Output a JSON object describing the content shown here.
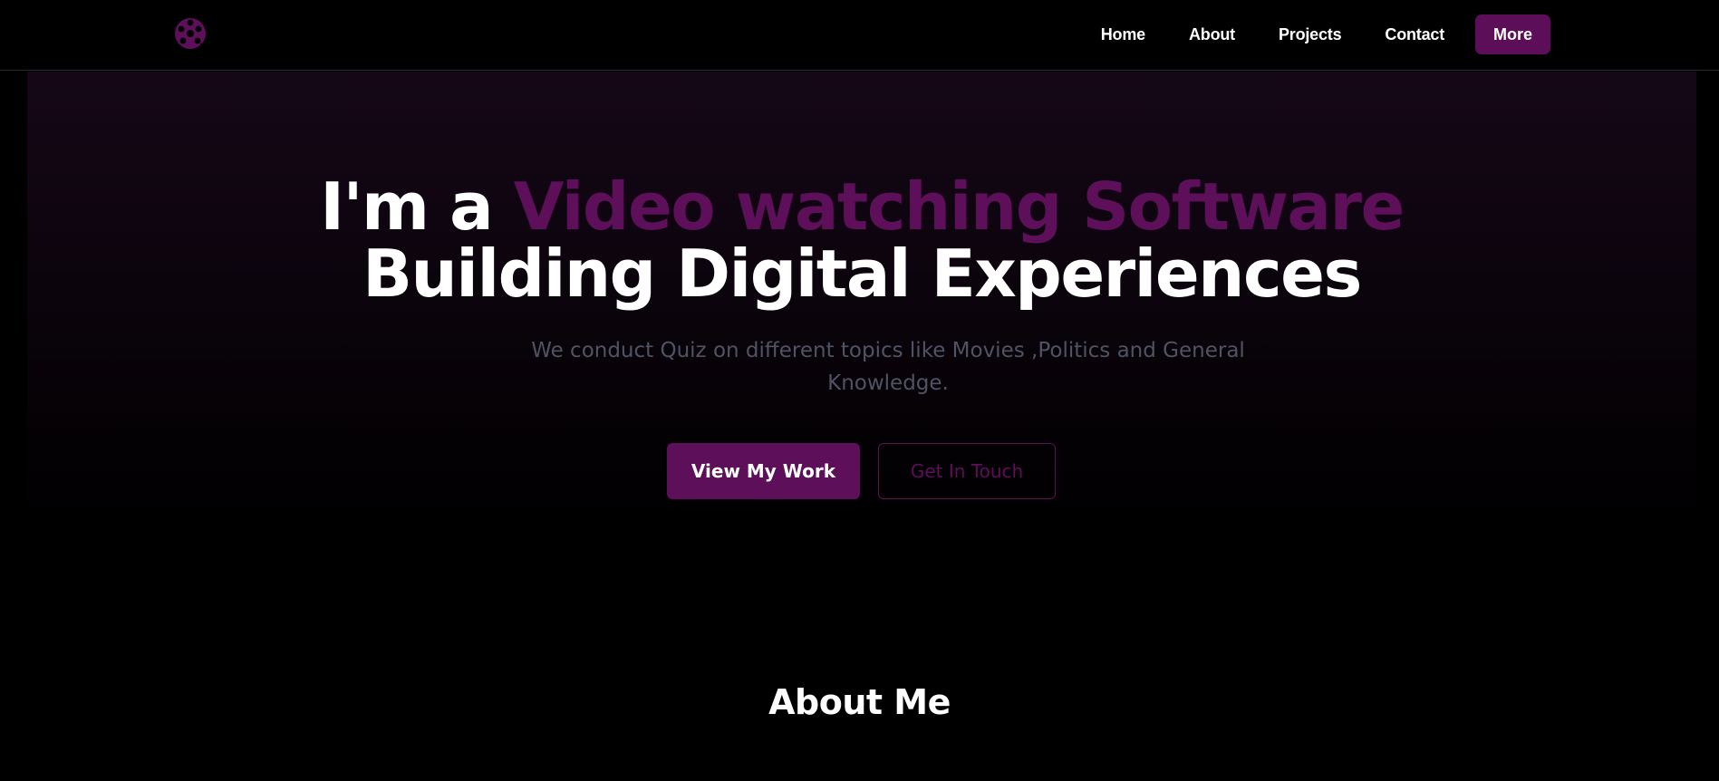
{
  "brand": {
    "logo_icon": "film-reel-icon",
    "accent_color": "#5e0f5a"
  },
  "nav": {
    "items": [
      {
        "label": "Home"
      },
      {
        "label": "About"
      },
      {
        "label": "Projects"
      },
      {
        "label": "Contact"
      }
    ],
    "more_label": "More"
  },
  "hero": {
    "title_prefix": "I'm a ",
    "title_accent": "Video watching Software",
    "title_line2": "Building Digital Experiences",
    "subtitle": "We conduct Quiz on different topics like Movies ,Politics and General Knowledge.",
    "primary_button": "View My Work",
    "secondary_button": "Get In Touch"
  },
  "about": {
    "heading": "About Me"
  }
}
